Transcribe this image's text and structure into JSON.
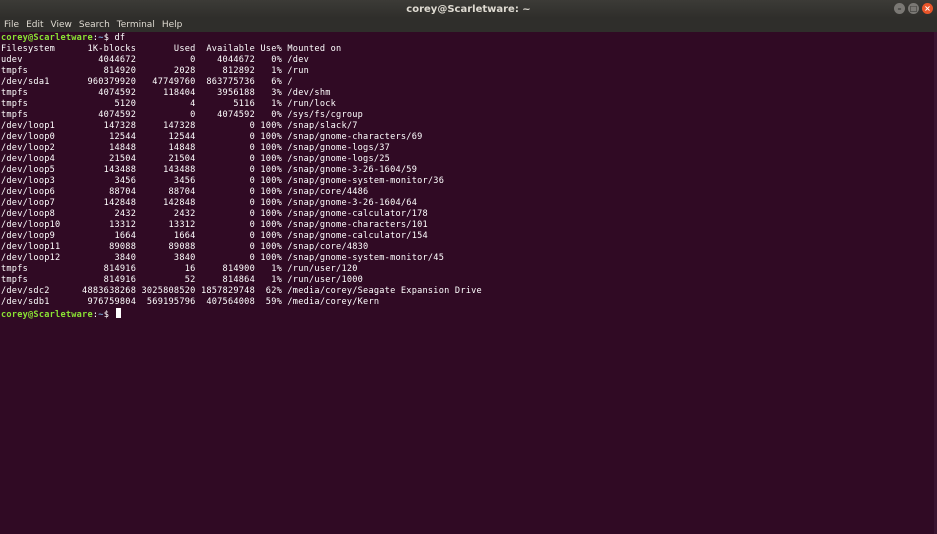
{
  "window": {
    "title": "corey@Scarletware: ~",
    "buttons": {
      "minimize": "–",
      "maximize": "□",
      "close": "×"
    }
  },
  "menu": [
    "File",
    "Edit",
    "View",
    "Search",
    "Terminal",
    "Help"
  ],
  "terminal": {
    "prompt_user": "corey@Scarletware",
    "prompt_sep": ":",
    "prompt_path": "~",
    "prompt_end": "$ ",
    "command": "df",
    "header": "Filesystem      1K-blocks       Used  Available Use% Mounted on",
    "rows": [
      "udev              4044672          0    4044672   0% /dev",
      "tmpfs              814920       2028     812892   1% /run",
      "/dev/sda1       960379920   47749760  863775736   6% /",
      "tmpfs             4074592     118404    3956188   3% /dev/shm",
      "tmpfs                5120          4       5116   1% /run/lock",
      "tmpfs             4074592          0    4074592   0% /sys/fs/cgroup",
      "/dev/loop1         147328     147328          0 100% /snap/slack/7",
      "/dev/loop0          12544      12544          0 100% /snap/gnome-characters/69",
      "/dev/loop2          14848      14848          0 100% /snap/gnome-logs/37",
      "/dev/loop4          21504      21504          0 100% /snap/gnome-logs/25",
      "/dev/loop5         143488     143488          0 100% /snap/gnome-3-26-1604/59",
      "/dev/loop3           3456       3456          0 100% /snap/gnome-system-monitor/36",
      "/dev/loop6          88704      88704          0 100% /snap/core/4486",
      "/dev/loop7         142848     142848          0 100% /snap/gnome-3-26-1604/64",
      "/dev/loop8           2432       2432          0 100% /snap/gnome-calculator/178",
      "/dev/loop10         13312      13312          0 100% /snap/gnome-characters/101",
      "/dev/loop9           1664       1664          0 100% /snap/gnome-calculator/154",
      "/dev/loop11         89088      89088          0 100% /snap/core/4830",
      "/dev/loop12          3840       3840          0 100% /snap/gnome-system-monitor/45",
      "tmpfs              814916         16     814900   1% /run/user/120",
      "tmpfs              814916         52     814864   1% /run/user/1000",
      "/dev/sdc2      4883638268 3025808520 1857829748  62% /media/corey/Seagate Expansion Drive",
      "/dev/sdb1       976759804  569195796  407564008  59% /media/corey/Kern"
    ]
  },
  "colors": {
    "background": "#300a24",
    "prompt_user": "#8ae234",
    "prompt_path": "#729fcf",
    "text": "#ffffff"
  }
}
